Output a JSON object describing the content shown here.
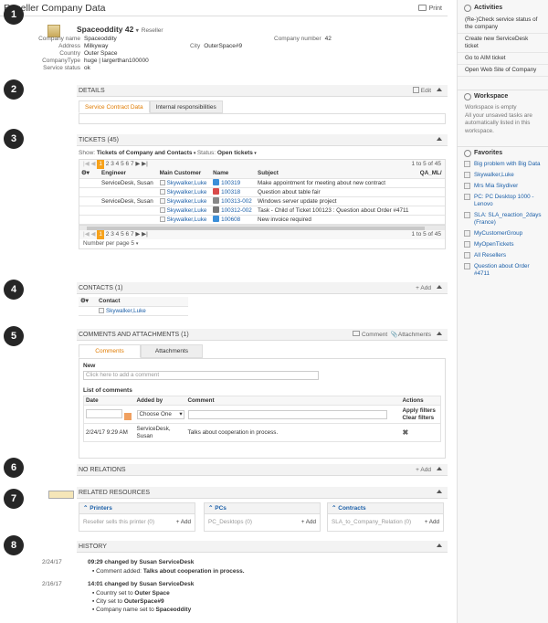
{
  "header": {
    "title": "Reseller Company Data",
    "print_label": "Print"
  },
  "steps": [
    "1",
    "2",
    "3",
    "4",
    "5",
    "6",
    "7",
    "8"
  ],
  "company": {
    "name": "Spaceoddity 42",
    "type_badge": "Reseller",
    "fields": {
      "company_name_label": "Company name",
      "company_name": "Spaceoddity",
      "address_label": "Address",
      "address": "Milkyway",
      "country_label": "Country",
      "country": "Outer Space",
      "companytype_label": "CompanyType",
      "companytype": "huge | largerthan100000",
      "status_label": "Service status",
      "status": "ok",
      "city_label": "City",
      "city": "OuterSpace#9",
      "company_number_label": "Company number",
      "company_number": "42"
    }
  },
  "details": {
    "title": "DETAILS",
    "edit_label": "Edit",
    "tabs": [
      "Service Contract Data",
      "Internal responsibilities"
    ]
  },
  "tickets": {
    "title": "TICKETS (45)",
    "show_label": "Show:",
    "filter": "Tickets of Company and Contacts",
    "status_label": "Status:",
    "status_value": "Open tickets",
    "pages": [
      "1",
      "2",
      "3",
      "4",
      "5",
      "6",
      "7"
    ],
    "range": "1 to 5 of 45",
    "columns": [
      "Engineer",
      "Main Customer",
      "Name",
      "Subject",
      "QA_ML/"
    ],
    "rows": [
      {
        "engineer": "ServiceDesk, Susan",
        "customer": "Skywalker,Luke",
        "name": "100319",
        "subject": "Make appointment for meeting about new contract",
        "icon_color": "#3b8fd9"
      },
      {
        "engineer": "",
        "customer": "Skywalker,Luke",
        "name": "100318",
        "subject": "Question about table fair",
        "icon_color": "#d94a4a"
      },
      {
        "engineer": "ServiceDesk, Susan",
        "customer": "Skywalker,Luke",
        "name": "100313-002",
        "subject": "Windows server update project",
        "icon_color": "#888888"
      },
      {
        "engineer": "",
        "customer": "Skywalker,Luke",
        "name": "100312-002",
        "subject": "Task - Child of Ticket 100123 : Question about Order #4711",
        "icon_color": "#777777"
      },
      {
        "engineer": "",
        "customer": "Skywalker,Luke",
        "name": "100608",
        "subject": "New invoice required",
        "icon_color": "#3b8fd9"
      }
    ],
    "per_page_label": "Number per page",
    "per_page": "5"
  },
  "contacts": {
    "title": "CONTACTS (1)",
    "add_label": "Add",
    "column": "Contact",
    "items": [
      "Skywalker,Luke"
    ]
  },
  "comments": {
    "title": "COMMENTS AND ATTACHMENTS (1)",
    "comment_btn": "Comment",
    "attachments_btn": "Attachments",
    "tabs": [
      "Comments",
      "Attachments"
    ],
    "new_label": "New",
    "new_placeholder": "Click here to add a comment",
    "list_label": "List of comments",
    "columns": [
      "Date",
      "Added by",
      "Comment",
      "Actions"
    ],
    "choose_one": "Choose One",
    "apply_filters": "Apply filters",
    "clear_filters": "Clear filters",
    "row": {
      "date": "2/24/17 9:29 AM",
      "by": "ServiceDesk, Susan",
      "comment": "Talks about cooperation in process."
    }
  },
  "relations": {
    "title": "NO RELATIONS",
    "add_label": "Add"
  },
  "resources": {
    "title": "RELATED RESOURCES",
    "boxes": [
      {
        "title": "Printers",
        "content": "Reseller sells this printer (0)",
        "add": "Add"
      },
      {
        "title": "PCs",
        "content": "PC_Desktops (0)",
        "add": "Add"
      },
      {
        "title": "Contracts",
        "content": "SLA_to_Company_Relation (0)",
        "add": "Add"
      }
    ]
  },
  "history": {
    "title": "HISTORY",
    "entries": [
      {
        "date": "2/24/17",
        "head": "09:29 changed by Susan ServiceDesk",
        "lines": [
          [
            "Comment added:",
            "Talks about cooperation in process."
          ]
        ]
      },
      {
        "date": "2/16/17",
        "head": "14:01 changed by Susan ServiceDesk",
        "lines": [
          [
            "Country set to",
            "Outer Space"
          ],
          [
            "City set to",
            "OuterSpace#9"
          ],
          [
            "Company name set to",
            "Spaceoddity"
          ]
        ]
      }
    ]
  },
  "sidebar": {
    "activities_title": "Activities",
    "activities": [
      "(Re-)Check service status of the company",
      "Create new ServiceDesk ticket",
      "Go to AIM ticket",
      "Open Web Site of Company"
    ],
    "workspace_title": "Workspace",
    "workspace_note": "Workspace is empty\nAll your unsaved tasks are automatically listed in this workspace.",
    "favorites_title": "Favorites",
    "favorites": [
      "Big problem with Big Data",
      "Skywalker,Luke",
      "Mrs Mia Skydiver",
      "PC: PC Desktop 1000 - Lenovo",
      "SLA: SLA_reaction_2days (France)",
      "MyCustomerGroup",
      "MyOpenTickets",
      "All Resellers",
      "Question about Order #4711"
    ]
  }
}
